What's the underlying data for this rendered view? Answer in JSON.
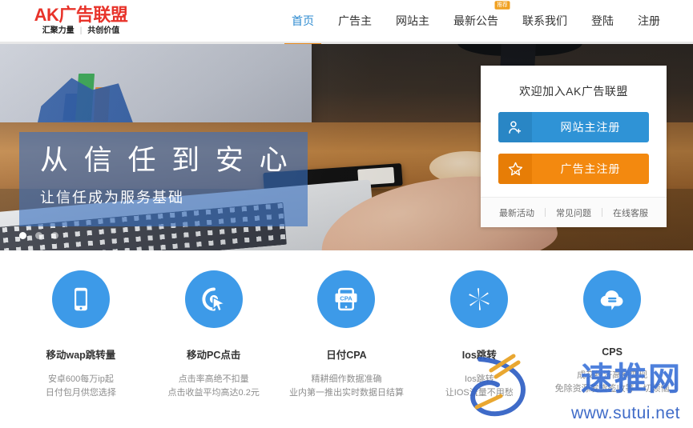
{
  "header": {
    "logo": {
      "main": "AK广告联盟",
      "sub_left": "汇聚力量",
      "sub_sep": "|",
      "sub_right": "共创价值"
    },
    "nav": [
      {
        "label": "首页",
        "active": true,
        "badge": ""
      },
      {
        "label": "广告主",
        "active": false,
        "badge": ""
      },
      {
        "label": "网站主",
        "active": false,
        "badge": ""
      },
      {
        "label": "最新公告",
        "active": false,
        "badge": "推荐"
      },
      {
        "label": "联系我们",
        "active": false,
        "badge": ""
      },
      {
        "label": "登陆",
        "active": false,
        "badge": ""
      },
      {
        "label": "注册",
        "active": false,
        "badge": ""
      }
    ],
    "active_color": "#2e8bd0",
    "underline_color": "#e8891c",
    "badge_color": "#f0a020"
  },
  "hero": {
    "title": "从 信 任 到 安 心",
    "subtitle": "让信任成为服务基础",
    "caption_bg": "#3870be",
    "dots": [
      {
        "active": true
      },
      {
        "active": false
      },
      {
        "active": false
      }
    ]
  },
  "panel": {
    "title": "欢迎加入AK广告联盟",
    "buttons": [
      {
        "label": "网站主注册",
        "icon": "user-plus-icon",
        "color": "#2f93d6"
      },
      {
        "label": "广告主注册",
        "icon": "star-check-icon",
        "color": "#f3890f"
      }
    ],
    "footer_links": [
      "最新活动",
      "常见问题",
      "在线客服"
    ]
  },
  "features": [
    {
      "icon": "mobile-phone-icon",
      "title": "移动wap跳转量",
      "lines": [
        "安卓600每万ip起",
        "日付包月供您选择"
      ]
    },
    {
      "icon": "click-cursor-icon",
      "title": "移动PC点击",
      "lines": [
        "点击率高绝不扣量",
        "点击收益平均高达0.2元"
      ]
    },
    {
      "icon": "cpa-device-icon",
      "title": "日付CPA",
      "lines": [
        "精耕细作数据准确",
        "业内第一推出实时数据日结算"
      ]
    },
    {
      "icon": "aperture-icon",
      "title": "Ios跳转",
      "lines": [
        "Ios跳转",
        "让IOS流量不用愁"
      ]
    },
    {
      "icon": "cloud-chat-icon",
      "title": "CPS",
      "lines": [
        "成交经济高额变现",
        "免除资源发货签收等一切烦恼"
      ]
    }
  ],
  "watermark": {
    "text": "速推网",
    "url": "www.sutui.net",
    "color": "#2f5fc4"
  }
}
